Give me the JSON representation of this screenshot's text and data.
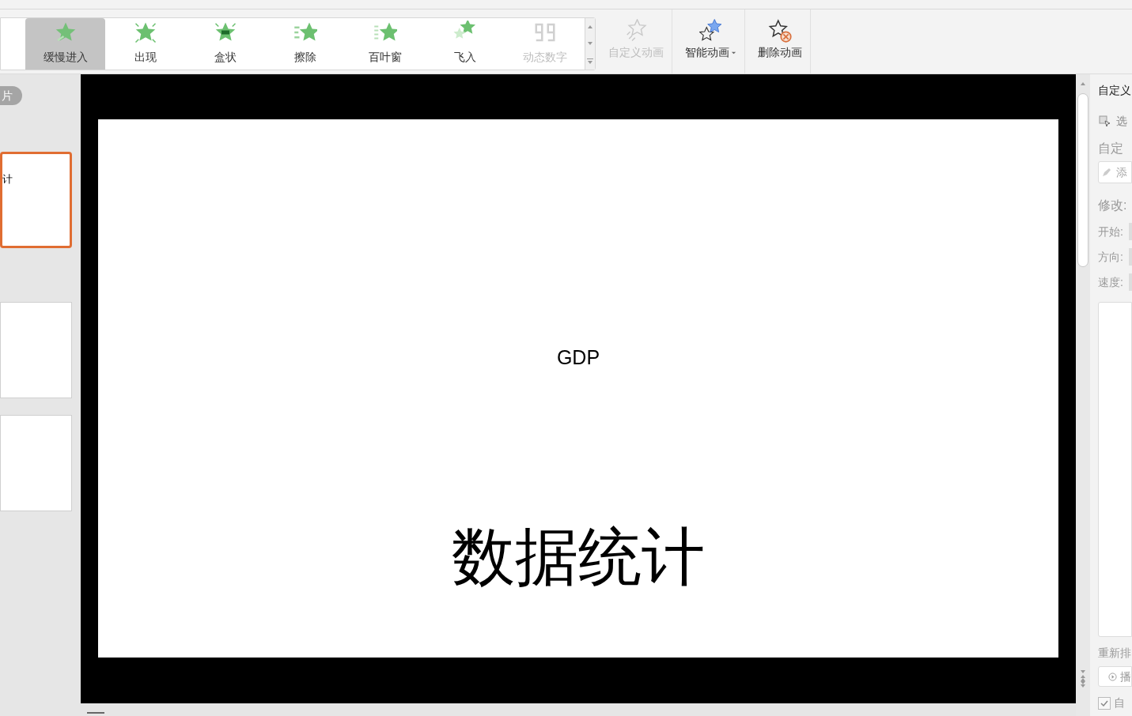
{
  "animation_gallery": [
    {
      "label": "缓慢进入",
      "selected": true,
      "disabled": false
    },
    {
      "label": "出现",
      "selected": false,
      "disabled": false
    },
    {
      "label": "盒状",
      "selected": false,
      "disabled": false
    },
    {
      "label": "擦除",
      "selected": false,
      "disabled": false
    },
    {
      "label": "百叶窗",
      "selected": false,
      "disabled": false
    },
    {
      "label": "飞入",
      "selected": false,
      "disabled": false
    },
    {
      "label": "动态数字",
      "selected": false,
      "disabled": true
    }
  ],
  "ribbon_buttons": [
    {
      "label": "自定义动画",
      "disabled": true,
      "dropdown": false
    },
    {
      "label": "智能动画",
      "disabled": false,
      "dropdown": true
    },
    {
      "label": "删除动画",
      "disabled": false,
      "dropdown": false
    }
  ],
  "slide_panel": {
    "tab_label": "片",
    "thumbnails": [
      {
        "text": "计",
        "selected": true
      },
      {
        "selected": false
      },
      {
        "selected": false
      }
    ]
  },
  "slide": {
    "subtitle": "GDP",
    "title": "数据统计"
  },
  "task_pane": {
    "title": "自定义",
    "select_label": "选",
    "section": "自定",
    "add_button": "添",
    "modify_label": "修改:",
    "fields": [
      "开始:",
      "方向:",
      "速度:"
    ],
    "reorder_label": "重新排",
    "play_button": "播",
    "autopreview": {
      "label": "自",
      "checked": true
    }
  }
}
